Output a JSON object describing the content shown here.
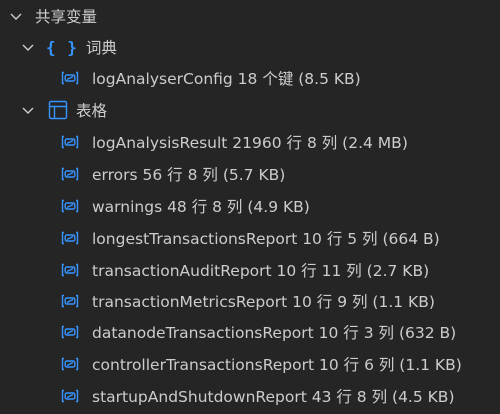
{
  "colors": {
    "background": "#252526",
    "text": "#cccccc",
    "icon_blue": "#3794ff"
  },
  "root": {
    "label": "共享变量",
    "expanded": true
  },
  "groups": {
    "dict": {
      "label": "词典",
      "icon": "braces-icon",
      "icon_glyph": "{ }",
      "items": [
        {
          "label": "logAnalyserConfig 18 个键 (8.5 KB)"
        }
      ]
    },
    "tables": {
      "label": "表格",
      "icon": "table-icon",
      "items": [
        {
          "label": "logAnalysisResult 21960 行 8 列 (2.4 MB)"
        },
        {
          "label": "errors 56 行 8 列 (5.7 KB)"
        },
        {
          "label": "warnings 48 行 8 列 (4.9 KB)"
        },
        {
          "label": "longestTransactionsReport 10 行 5 列 (664 B)"
        },
        {
          "label": "transactionAuditReport 10 行 11 列 (2.7 KB)"
        },
        {
          "label": "transactionMetricsReport 10 行 9 列 (1.1 KB)"
        },
        {
          "label": "datanodeTransactionsReport 10 行 3 列 (632 B)"
        },
        {
          "label": "controllerTransactionsReport 10 行 6 列 (1.1 KB)"
        },
        {
          "label": "startupAndShutdownReport 43 行 8 列 (4.5 KB)"
        }
      ]
    }
  }
}
